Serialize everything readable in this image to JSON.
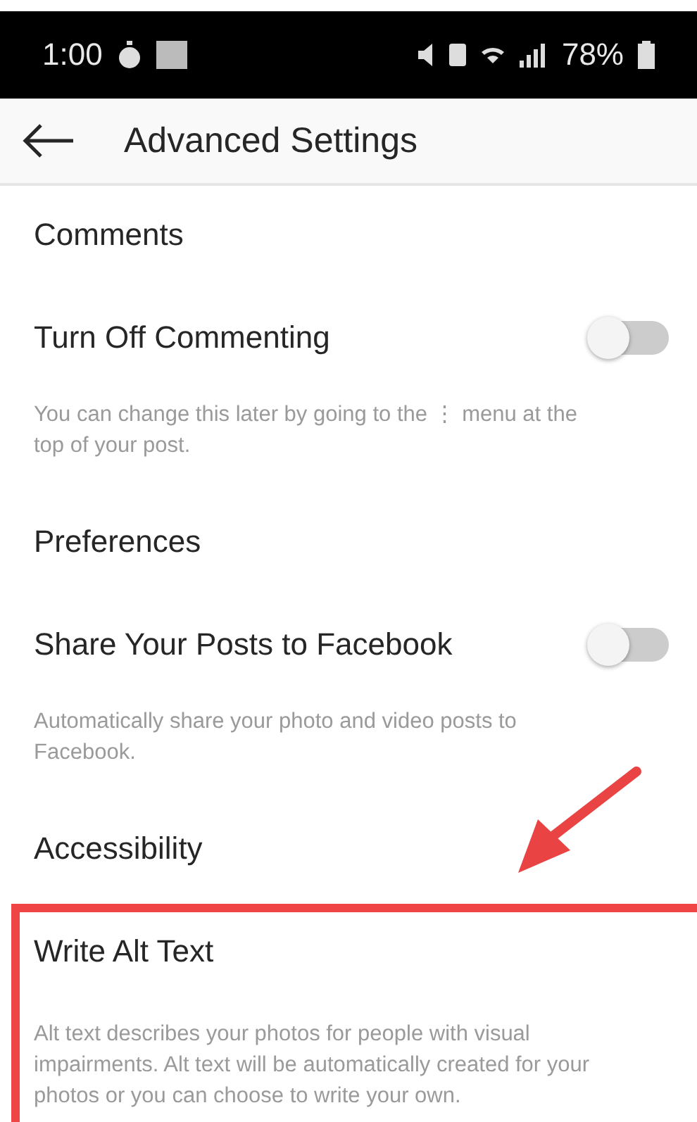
{
  "status_bar": {
    "time": "1:00",
    "battery": "78%"
  },
  "header": {
    "title": "Advanced Settings"
  },
  "sections": [
    {
      "title": "Comments",
      "items": [
        {
          "kind": "toggle",
          "label": "Turn Off Commenting",
          "on": false,
          "highlighted": false,
          "description": "You can change this later by going to the ⋮ menu at the top of your post."
        }
      ]
    },
    {
      "title": "Preferences",
      "items": [
        {
          "kind": "toggle",
          "label": "Share Your Posts to Facebook",
          "on": false,
          "highlighted": false,
          "description": "Automatically share your photo and video posts to Facebook."
        }
      ]
    },
    {
      "title": "Accessibility",
      "items": [
        {
          "kind": "link",
          "label": "Write Alt Text",
          "highlighted": true,
          "description": "Alt text describes your photos for people with visual impairments. Alt text will be automatically created for your photos or you can choose to write your own."
        }
      ]
    }
  ]
}
